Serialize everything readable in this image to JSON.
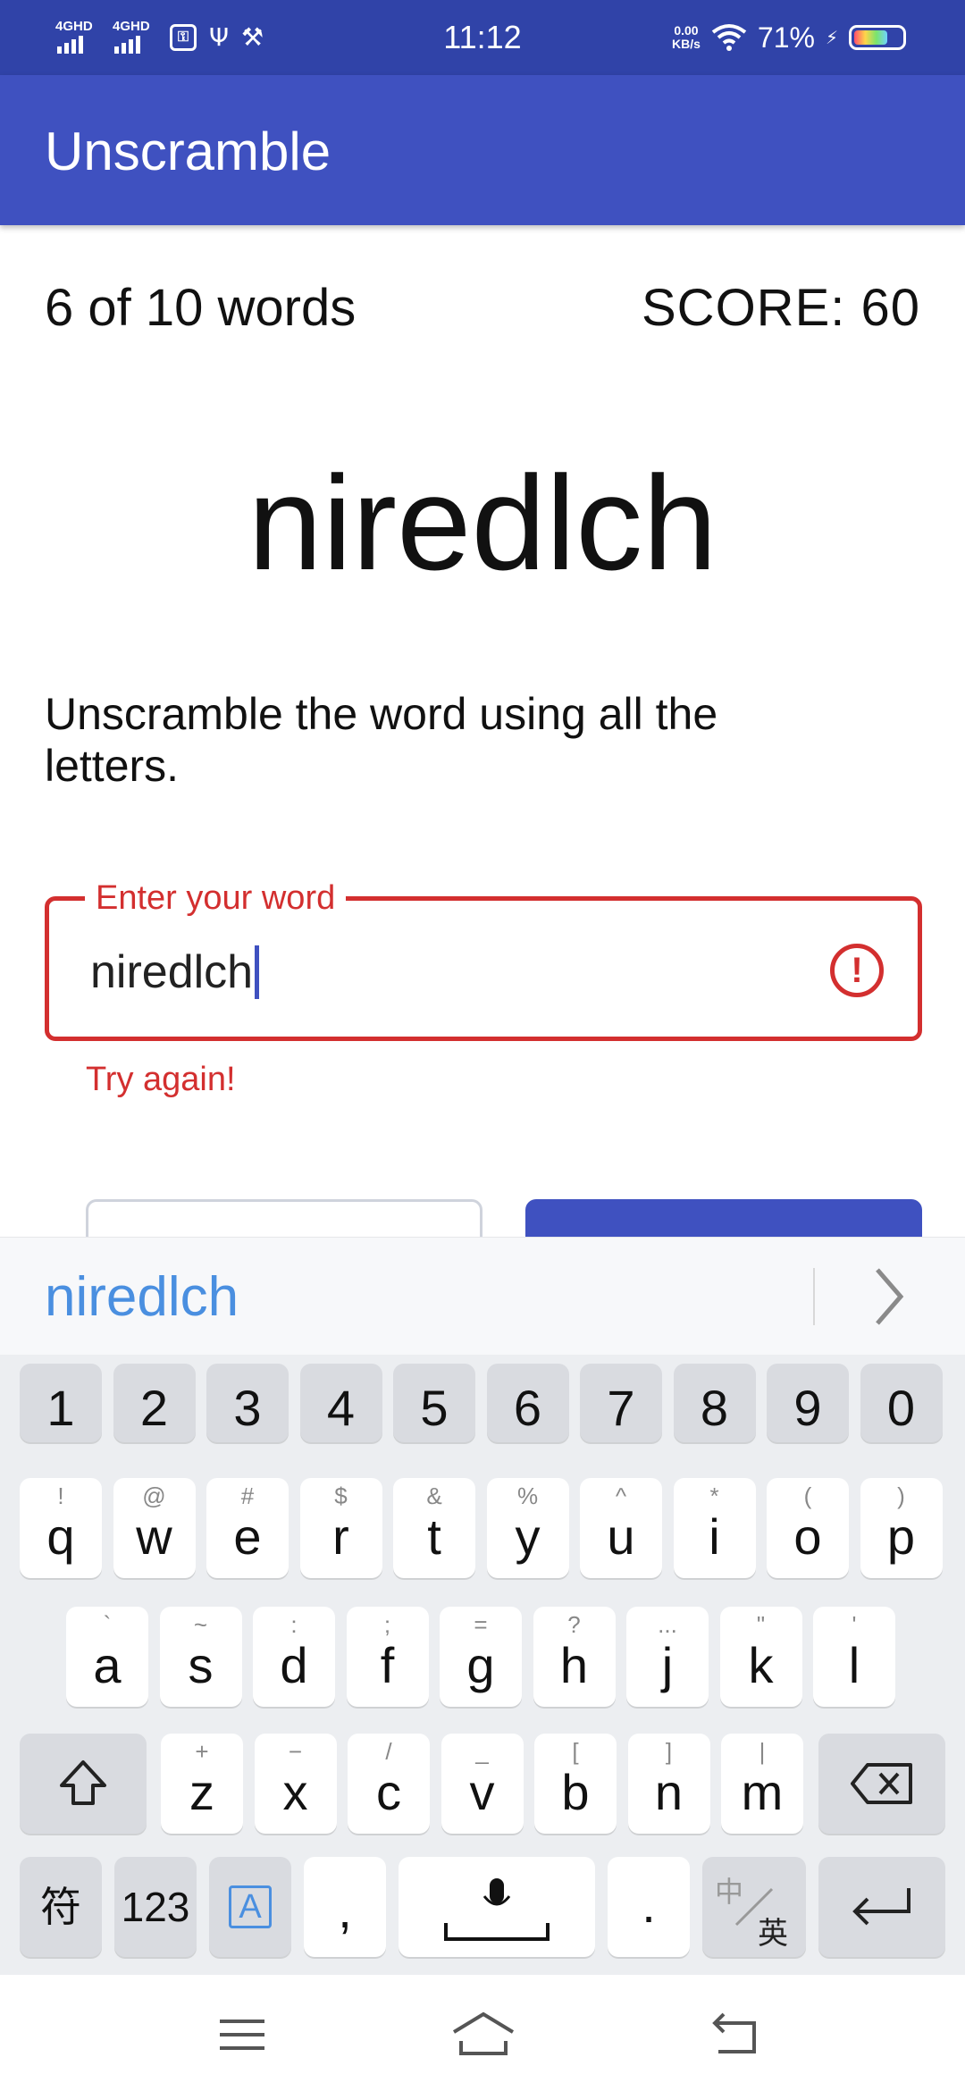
{
  "status_bar": {
    "signal_1": "4GHD",
    "signal_2": "4GHD",
    "time": "11:12",
    "net_speed_value": "0.00",
    "net_speed_unit": "KB/s",
    "battery_percent": "71%",
    "battery_level": 0.71,
    "icons": [
      "signal-icon",
      "usb-debug-icon",
      "usb-icon",
      "tools-icon",
      "wifi-icon",
      "charging-icon",
      "battery-icon"
    ]
  },
  "app_bar": {
    "title": "Unscramble",
    "color": "#3f51c0"
  },
  "game": {
    "word_count": "6 of 10 words",
    "score": "SCORE: 60",
    "scrambled_word": "niredlch",
    "instructions": "Unscramble the word using all the letters."
  },
  "input": {
    "label": "Enter your word",
    "value": "niredlch",
    "error_text": "Try again!",
    "error_color": "#d32f2f",
    "icon": "error-icon"
  },
  "suggestion": {
    "word": "niredlch",
    "icon": "chevron-right-icon"
  },
  "keyboard": {
    "number_row": [
      "1",
      "2",
      "3",
      "4",
      "5",
      "6",
      "7",
      "8",
      "9",
      "0"
    ],
    "row1": [
      {
        "key": "q",
        "hint": "!"
      },
      {
        "key": "w",
        "hint": "@"
      },
      {
        "key": "e",
        "hint": "#"
      },
      {
        "key": "r",
        "hint": "$"
      },
      {
        "key": "t",
        "hint": "&"
      },
      {
        "key": "y",
        "hint": "%"
      },
      {
        "key": "u",
        "hint": "^"
      },
      {
        "key": "i",
        "hint": "*"
      },
      {
        "key": "o",
        "hint": "("
      },
      {
        "key": "p",
        "hint": ")"
      }
    ],
    "row2": [
      {
        "key": "a",
        "hint": "`"
      },
      {
        "key": "s",
        "hint": "~"
      },
      {
        "key": "d",
        "hint": ":"
      },
      {
        "key": "f",
        "hint": ";"
      },
      {
        "key": "g",
        "hint": "="
      },
      {
        "key": "h",
        "hint": "?"
      },
      {
        "key": "j",
        "hint": "..."
      },
      {
        "key": "k",
        "hint": "\""
      },
      {
        "key": "l",
        "hint": "'"
      }
    ],
    "row3": [
      {
        "key": "z",
        "hint": "+"
      },
      {
        "key": "x",
        "hint": "−"
      },
      {
        "key": "c",
        "hint": "/"
      },
      {
        "key": "v",
        "hint": "_"
      },
      {
        "key": "b",
        "hint": "["
      },
      {
        "key": "n",
        "hint": "]"
      },
      {
        "key": "m",
        "hint": "|"
      }
    ],
    "symbols_key": "符",
    "numbers_key": "123",
    "ime_key": "A",
    "comma_key": ",",
    "period_key": ".",
    "lang_key_top": "中",
    "lang_key_bottom": "英",
    "icons": [
      "shift-icon",
      "backspace-icon",
      "microphone-icon",
      "enter-icon"
    ]
  },
  "nav_bar": {
    "icons": [
      "menu-icon",
      "home-icon",
      "back-icon"
    ]
  }
}
